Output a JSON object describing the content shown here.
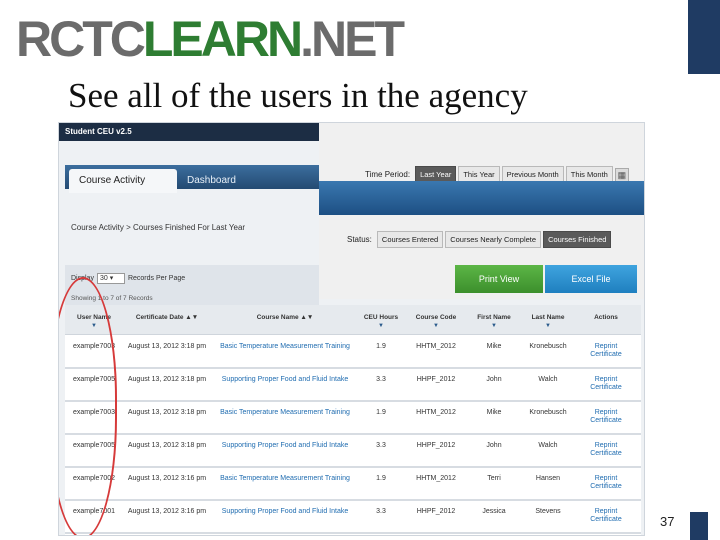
{
  "slide": {
    "logo_part1": "RCTC",
    "logo_part2": "LEARN",
    "logo_part3": ".NET",
    "title": "See all of the users in the agency",
    "page_number": "37"
  },
  "app": {
    "title": "Student CEU v2.5",
    "tabs": [
      "Course Activity",
      "Dashboard"
    ],
    "breadcrumb": "Course Activity   > Courses Finished For Last Year"
  },
  "filters": {
    "time_label": "Time Period:",
    "time_options": [
      "Last Year",
      "This Year",
      "Previous Month",
      "This Month"
    ],
    "time_selected": "Last Year",
    "status_label": "Status:",
    "status_options": [
      "Courses Entered",
      "Courses Nearly Complete",
      "Courses Finished"
    ],
    "status_selected": "Courses Finished",
    "print_label": "Print View",
    "excel_label": "Excel File"
  },
  "records": {
    "display_label": "Display",
    "per_page_value": "30",
    "per_page_label": "Records Per Page",
    "showing": "Showing 1 to 7 of 7 Records"
  },
  "table": {
    "headers": [
      "User Name",
      "Certificate Date",
      "Course Name",
      "CEU Hours",
      "Course Code",
      "First Name",
      "Last Name",
      "Actions"
    ],
    "rows": [
      {
        "user": "example7003",
        "date": "August 13, 2012 3:18 pm",
        "course": "Basic Temperature Measurement Training",
        "ceu": "1.9",
        "code": "HHTM_2012",
        "first": "Mike",
        "last": "Kronebusch",
        "action": "Reprint Certificate"
      },
      {
        "user": "example7005",
        "date": "August 13, 2012 3:18 pm",
        "course": "Supporting Proper Food and Fluid Intake",
        "ceu": "3.3",
        "code": "HHPF_2012",
        "first": "John",
        "last": "Walch",
        "action": "Reprint Certificate"
      },
      {
        "user": "example7003",
        "date": "August 13, 2012 3:18 pm",
        "course": "Basic Temperature Measurement Training",
        "ceu": "1.9",
        "code": "HHTM_2012",
        "first": "Mike",
        "last": "Kronebusch",
        "action": "Reprint Certificate"
      },
      {
        "user": "example7005",
        "date": "August 13, 2012 3:18 pm",
        "course": "Supporting Proper Food and Fluid Intake",
        "ceu": "3.3",
        "code": "HHPF_2012",
        "first": "John",
        "last": "Walch",
        "action": "Reprint Certificate"
      },
      {
        "user": "example7002",
        "date": "August 13, 2012 3:16 pm",
        "course": "Basic Temperature Measurement Training",
        "ceu": "1.9",
        "code": "HHTM_2012",
        "first": "Terri",
        "last": "Hansen",
        "action": "Reprint Certificate"
      },
      {
        "user": "example7001",
        "date": "August 13, 2012 3:16 pm",
        "course": "Supporting Proper Food and Fluid Intake",
        "ceu": "3.3",
        "code": "HHPF_2012",
        "first": "Jessica",
        "last": "Stevens",
        "action": "Reprint Certificate"
      }
    ]
  },
  "colors": {
    "accent_navy": "#1f3b63",
    "logo_green": "#2e7d32",
    "highlight_circle": "#d63a3a",
    "link_blue": "#1f6cb0"
  }
}
